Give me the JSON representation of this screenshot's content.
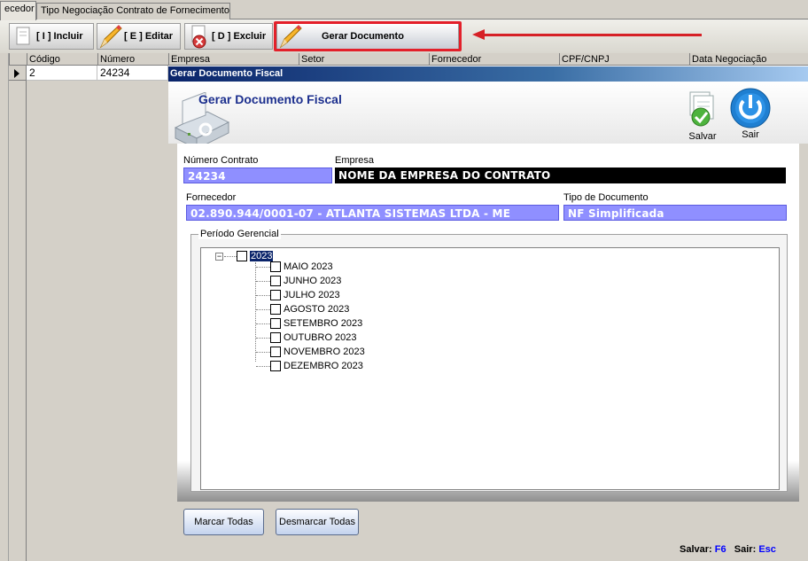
{
  "tabs": [
    "ecedor",
    "Tipo Negociação Contrato de Fornecimento"
  ],
  "toolbar": {
    "incluir": "[ I ] Incluir",
    "editar": "[ E ] Editar",
    "excluir": "[ D ] Excluir",
    "gerar": "Gerar Documento"
  },
  "grid": {
    "columns": [
      "Código",
      "Número",
      "Empresa",
      "Setor",
      "Fornecedor",
      "CPF/CNPJ",
      "Data Negociação"
    ],
    "rows": [
      {
        "codigo": "2",
        "numero": "24234"
      }
    ]
  },
  "form": {
    "window_title": "Gerar Documento Fiscal",
    "header_title": "Gerar Documento Fiscal",
    "salvar": "Salvar",
    "sair": "Sair",
    "numero_contrato_label": "Número Contrato",
    "numero_contrato_value": "24234",
    "empresa_label": "Empresa",
    "empresa_value": "NOME DA EMPRESA DO CONTRATO",
    "fornecedor_label": "Fornecedor",
    "fornecedor_value": "02.890.944/0001-07 - ATLANTA SISTEMAS LTDA - ME",
    "tipo_documento_label": "Tipo de Documento",
    "tipo_documento_value": "NF Simplificada",
    "periodo_label": "Período Gerencial",
    "tree": {
      "expander": "−",
      "year": "2023",
      "months": [
        "MAIO 2023",
        "JUNHO 2023",
        "JULHO 2023",
        "AGOSTO 2023",
        "SETEMBRO 2023",
        "OUTUBRO 2023",
        "NOVEMBRO 2023",
        "DEZEMBRO 2023"
      ]
    },
    "marcar_todas": "Marcar Todas",
    "desmarcar_todas": "Desmarcar Todas",
    "status": {
      "salvar_label": "Salvar:",
      "salvar_key": "F6",
      "sair_label": "Sair:",
      "sair_key": "Esc"
    }
  },
  "colors": {
    "highlight": "#e3202a",
    "field_blue": "#8f8fff",
    "title_blue": "#1c2f8e",
    "key_blue": "#0000ff"
  }
}
